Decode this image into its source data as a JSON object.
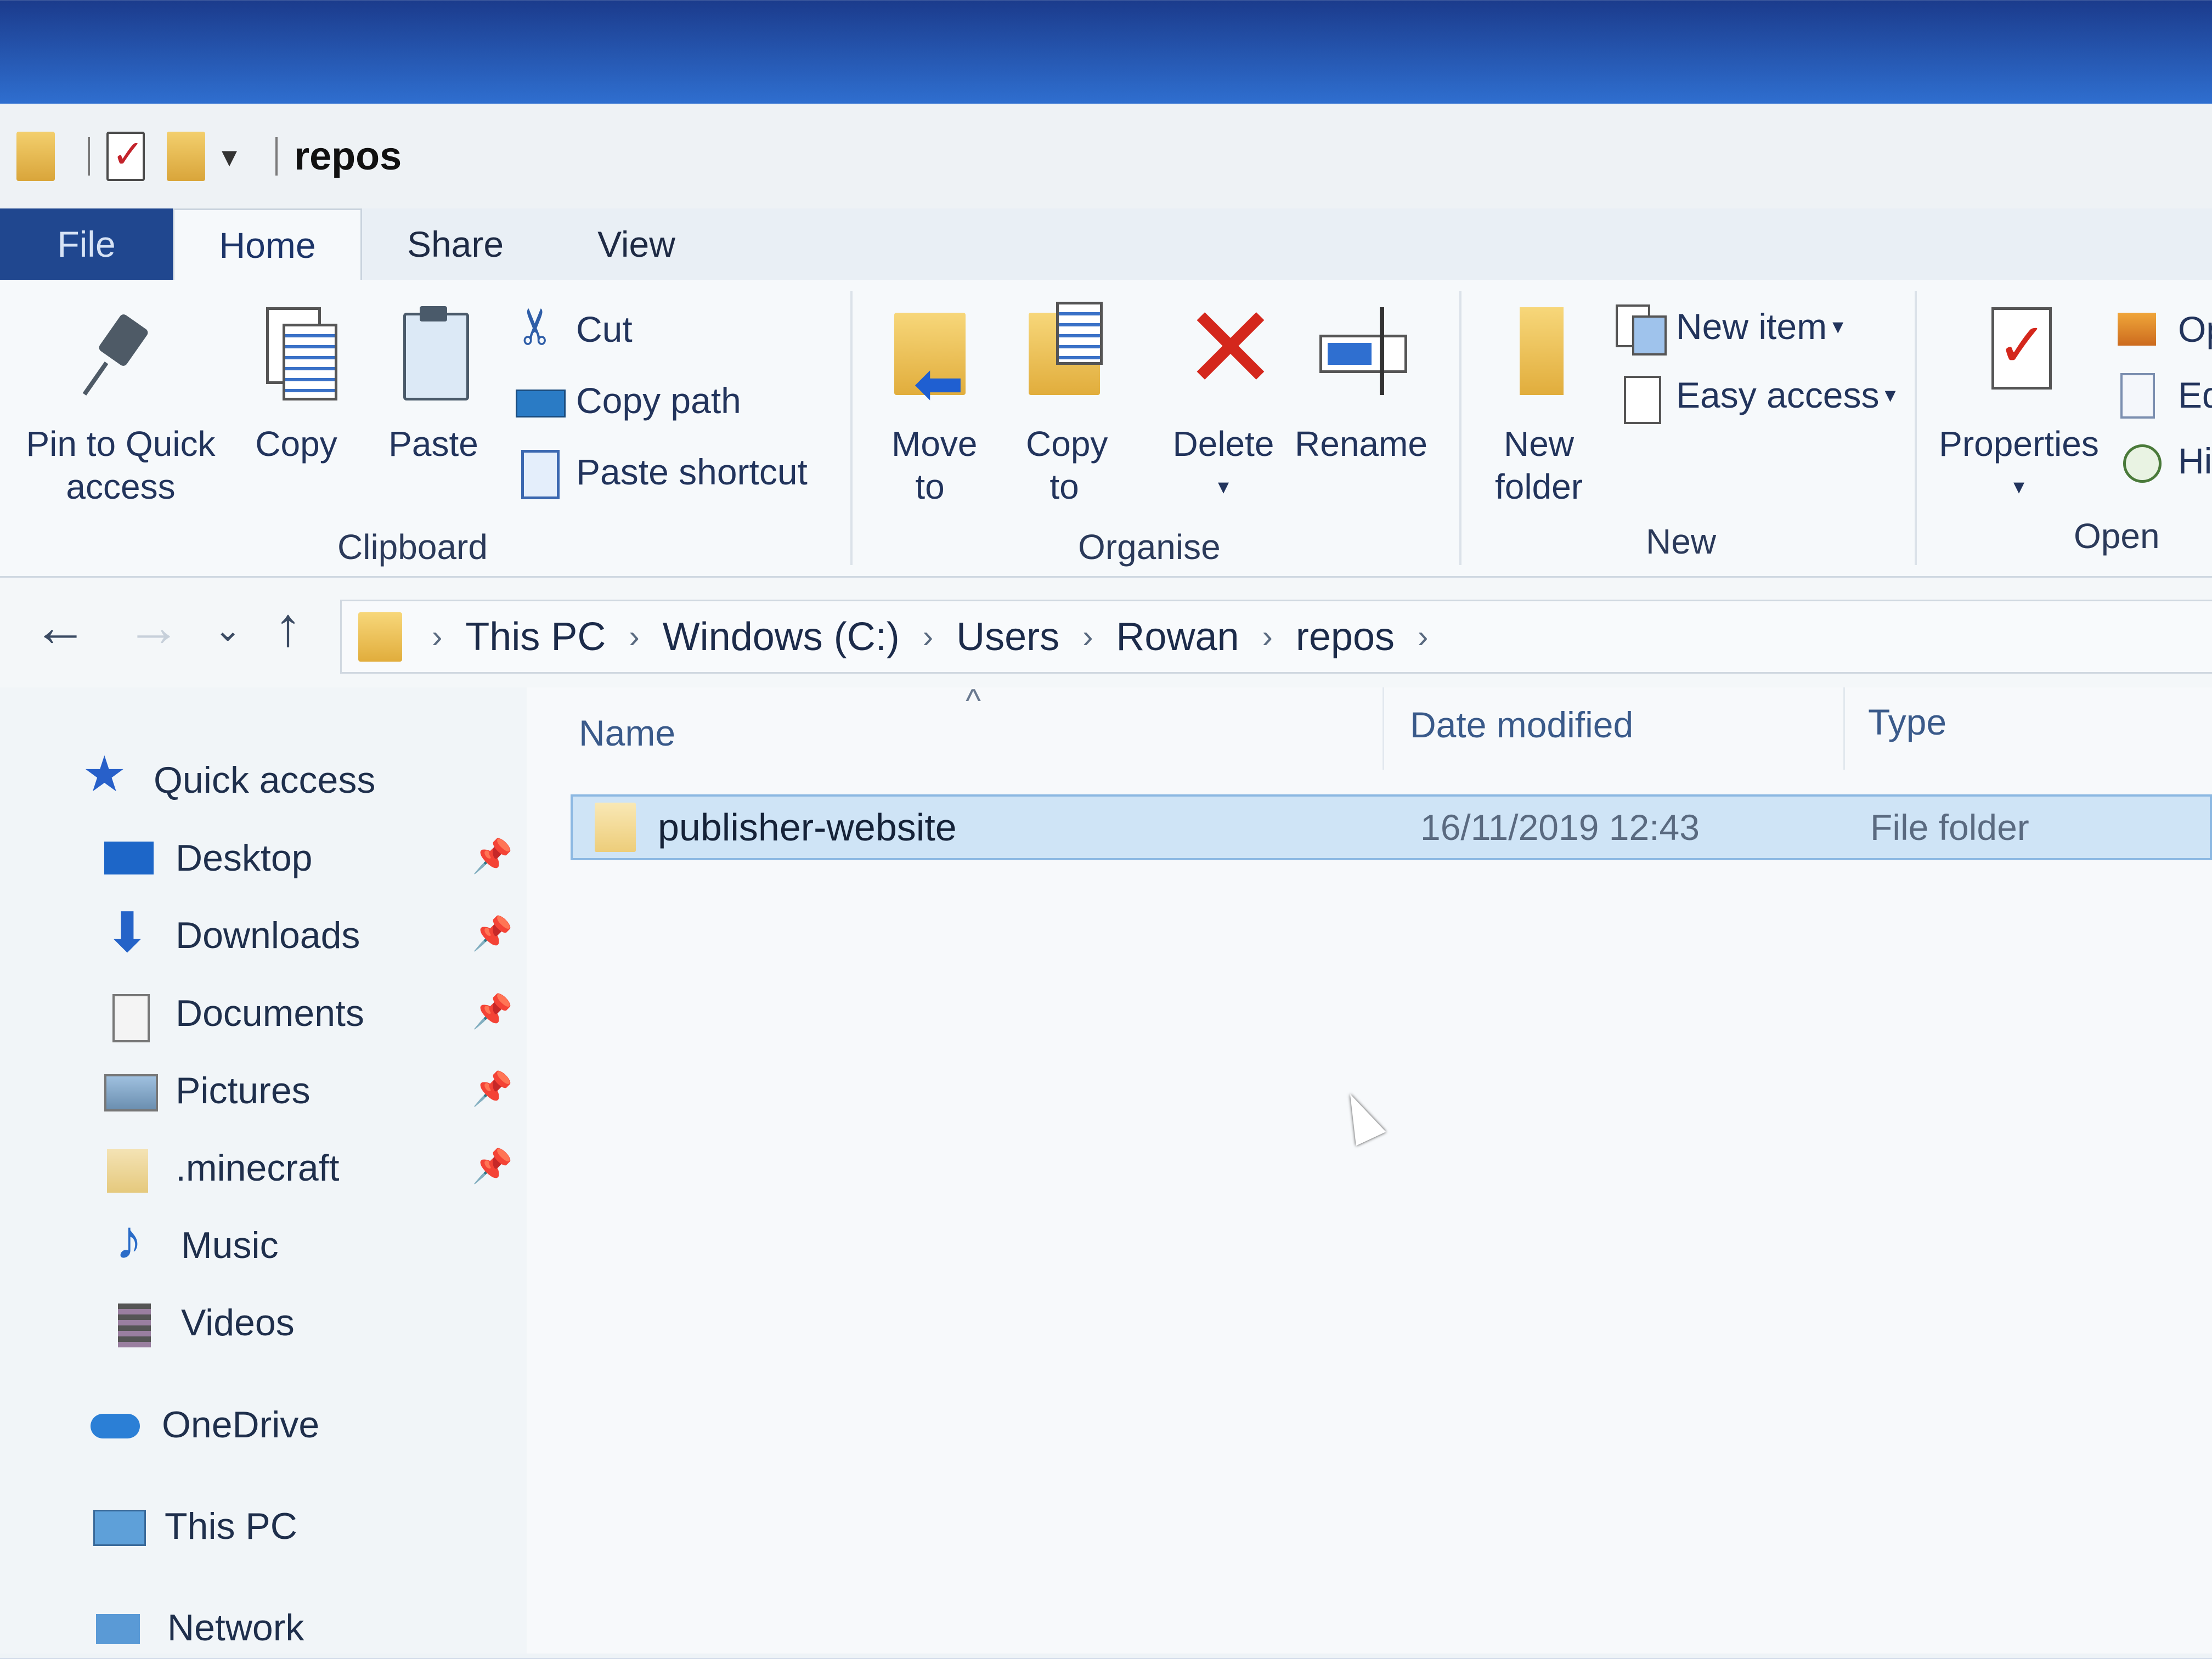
{
  "window": {
    "title": "repos"
  },
  "quick_access_toolbar": {
    "icons": [
      "folder-icon",
      "properties-icon",
      "new-folder-icon",
      "customize-dropdown-icon"
    ]
  },
  "tabs": [
    "File",
    "Home",
    "Share",
    "View"
  ],
  "ribbon": {
    "clipboard": {
      "label": "Clipboard",
      "pin": "Pin to Quick access",
      "copy": "Copy",
      "paste": "Paste",
      "cut": "Cut",
      "copy_path": "Copy path",
      "paste_shortcut": "Paste shortcut"
    },
    "organise": {
      "label": "Organise",
      "move_to": "Move to",
      "copy_to": "Copy to",
      "delete": "Delete",
      "rename": "Rename"
    },
    "new": {
      "label": "New",
      "new_folder": "New folder",
      "new_item": "New item",
      "easy_access": "Easy access"
    },
    "open": {
      "label": "Open",
      "properties": "Properties",
      "open_partial": "Op",
      "edit_partial": "Ed",
      "history_partial": "Hi"
    }
  },
  "address": {
    "crumbs": [
      "This PC",
      "Windows (C:)",
      "Users",
      "Rowan",
      "repos"
    ]
  },
  "nav_pane": {
    "quick_access": "Quick access",
    "items": [
      "Desktop",
      "Downloads",
      "Documents",
      "Pictures",
      ".minecraft",
      "Music",
      "Videos"
    ],
    "onedrive": "OneDrive",
    "this_pc": "This PC",
    "network": "Network"
  },
  "file_list": {
    "columns": {
      "name": "Name",
      "date": "Date modified",
      "type": "Type"
    },
    "rows": [
      {
        "name": "publisher-website",
        "date": "16/11/2019 12:43",
        "type": "File folder"
      }
    ]
  }
}
